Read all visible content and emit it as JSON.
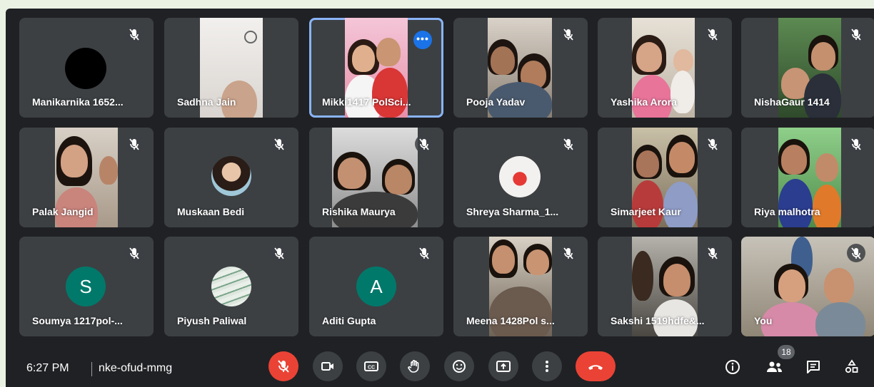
{
  "participants": [
    {
      "name": "Manikarnika 1652...",
      "muted": true
    },
    {
      "name": "Sadhna Jain",
      "muted": false
    },
    {
      "name": "Mikki1417 PolSci...",
      "muted": false,
      "pinned_focus": true
    },
    {
      "name": "Pooja Yadav",
      "muted": true
    },
    {
      "name": "Yashika Arora",
      "muted": true
    },
    {
      "name": "NishaGaur 1414",
      "muted": true
    },
    {
      "name": "Palak Jangid",
      "muted": true
    },
    {
      "name": "Muskaan Bedi",
      "muted": true
    },
    {
      "name": "Rishika Maurya",
      "muted": true
    },
    {
      "name": "Shreya Sharma_1...",
      "muted": true
    },
    {
      "name": "Simarjeet Kaur",
      "muted": true
    },
    {
      "name": "Riya malhotra",
      "muted": true
    },
    {
      "name": "Soumya 1217pol-...",
      "muted": true,
      "initial": "S",
      "avatar_color": "#00796b"
    },
    {
      "name": "Piyush Paliwal",
      "muted": true
    },
    {
      "name": "Aditi Gupta",
      "muted": true,
      "initial": "A",
      "avatar_color": "#00796b"
    },
    {
      "name": "Meena 1428Pol s...",
      "muted": true
    },
    {
      "name": "Sakshi 1519hdfe&...",
      "muted": true
    },
    {
      "name": "You",
      "muted": true
    }
  ],
  "bottom_bar": {
    "time": "6:27 PM",
    "meeting_code": "nke-ofud-mmg",
    "participant_count": "18",
    "controls": [
      "mic-off",
      "camera",
      "captions",
      "raise-hand",
      "reactions",
      "present",
      "more-options",
      "leave-call"
    ],
    "right_controls": [
      "info",
      "people",
      "chat",
      "activities"
    ]
  },
  "colors": {
    "background": "#202124",
    "tile": "#3c4043",
    "red": "#ea4335",
    "accent": "#8ab4f8"
  }
}
